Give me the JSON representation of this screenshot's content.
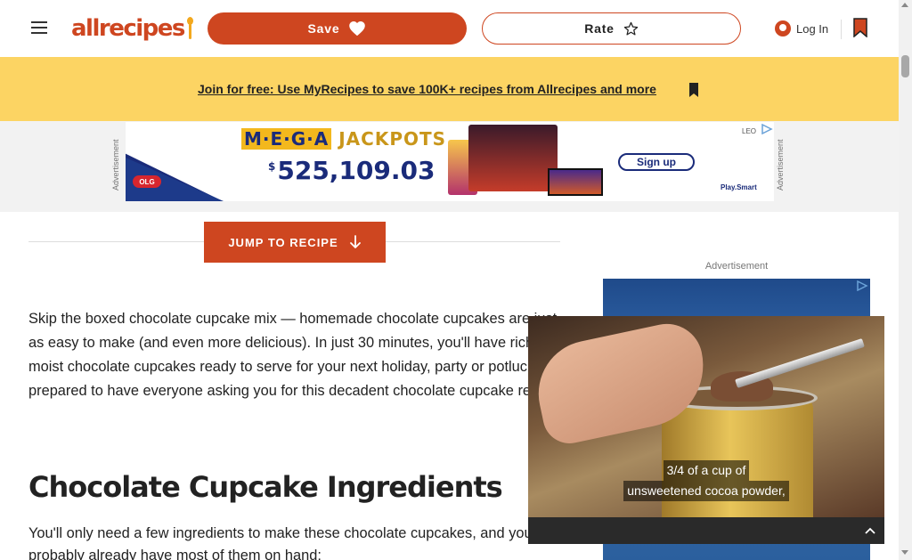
{
  "header": {
    "logo_text": "allrecipes",
    "save_label": "Save",
    "rate_label": "Rate",
    "login_label": "Log In"
  },
  "promo": {
    "link_text": "Join for free: Use MyRecipes to save 100K+ recipes from Allrecipes and more"
  },
  "top_ad": {
    "side_label": "Advertisement",
    "title_mega": "M·E·G·A",
    "title_jackpots": "JACKPOTS",
    "currency": "$",
    "amount": "525,109.03",
    "signup_label": "Sign up",
    "brand": "Play.Smart",
    "sponsor": "LEO",
    "olg": "OLG"
  },
  "article": {
    "jump_label": "JUMP TO RECIPE",
    "intro": "Skip the boxed chocolate cupcake mix — homemade chocolate cupcakes are just as easy to make (and even more delicious). In just 30 minutes, you'll have rich and moist chocolate cupcakes ready to serve for your next holiday, party or potluck. Be prepared to have everyone asking you for this decadent chocolate cupcake recipe!",
    "heading": "Chocolate Cupcake Ingredients",
    "ingredients_intro": "You'll only need a few ingredients to make these chocolate cupcakes, and you probably already have most of them on hand:"
  },
  "right_ad": {
    "label": "Advertisement"
  },
  "video": {
    "caption_line1": "3/4 of a cup of",
    "caption_line2": "unsweetened cocoa powder,"
  },
  "colors": {
    "brand": "#ce4620",
    "promo_bg": "#fcd463",
    "ad_bg": "#f2f2f2"
  }
}
